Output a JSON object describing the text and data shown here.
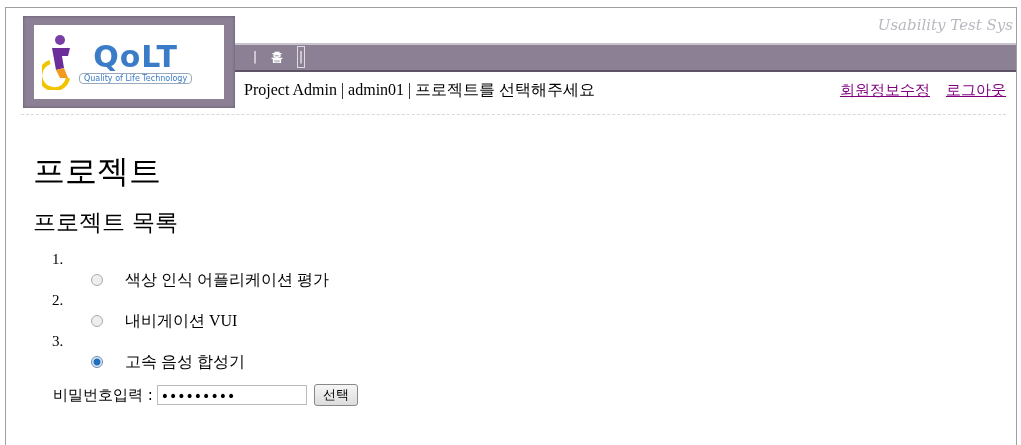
{
  "header": {
    "logo": {
      "wordmark": "QoLT",
      "tagline": "Quality of Life Technology"
    },
    "system_title": "Usability Test Sys",
    "nav": [
      {
        "label": "|",
        "kind": "separator",
        "focused": false
      },
      {
        "label": "홈",
        "kind": "link",
        "focused": false
      },
      {
        "label": "|",
        "kind": "separator",
        "focused": true
      }
    ],
    "user_info": "Project Admin | admin01 | 프로젝트를 선택해주세요",
    "links": [
      "회원정보수정",
      "로그아웃"
    ]
  },
  "page_title": "프로젝트",
  "section_title": "프로젝트 목록",
  "projects": [
    {
      "number": "1.",
      "name": "색상 인식 어플리케이션 평가",
      "selected": false
    },
    {
      "number": "2.",
      "name": "내비게이션 VUI",
      "selected": false
    },
    {
      "number": "3.",
      "name": "고속 음성 합성기",
      "selected": true
    }
  ],
  "password": {
    "label": "비밀번호입력 :",
    "value": "•••••••••"
  },
  "submit_button": "선택"
}
